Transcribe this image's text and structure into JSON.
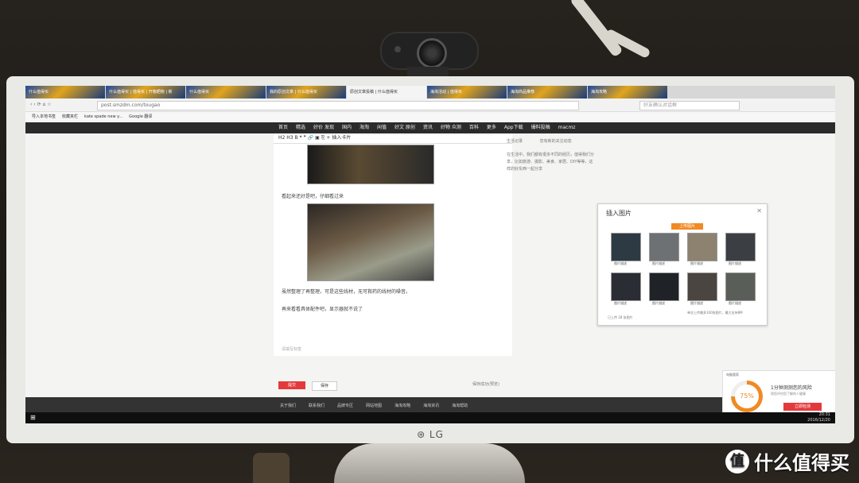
{
  "browser": {
    "tabs": [
      "什么值得买",
      "什么值得买 | 值得买 | 开箱晒物 | 新",
      "什么值得买",
      "我的原创文章 | 什么值得买",
      "原创文章投稿 | 什么值得买",
      "海淘活动 | 值得买",
      "海淘商品推荐",
      "海淘攻略"
    ],
    "active_tab_index": 4,
    "url": "post.smzdm.com/tougao",
    "search_placeholder": "好友确认对话框",
    "bookmarks": [
      "导入本地书签",
      "收藏夹栏",
      "kate spade new y...",
      "Google 翻译"
    ]
  },
  "site_nav": [
    "首页",
    "精选",
    "好价 发现",
    "国内",
    "海淘",
    "闲值",
    "好文 原创",
    "资讯",
    "好物 众测",
    "百科",
    "更多",
    "App下载",
    "爆料投稿",
    "macmz"
  ],
  "editor": {
    "toolbar": "H2  H3  B  ❝  ❞  🔗  ▣  ⎘  +  插入卡片",
    "caption1": "看起来还好是吧，仔细看过来",
    "text1": "虽然整理了再整理，可是这些线材，无可救药的线材的噪音。",
    "text2": "再来看看具体配件吧，显示器就不说了",
    "placeholder": "清填写标签",
    "submit_label": "提交",
    "save_label": "保存",
    "saved_text": "保存成功(预览)"
  },
  "sidebar": {
    "tab1": "生活记录",
    "tab2": "您有新的关注动态",
    "para": "在生活中，我们都有很多不同的经历，值得我们分享，比如旅游、摄影、美食、家居、DIY等等，这样的好东西一起分享"
  },
  "dialog": {
    "title": "插入图片",
    "upload_label": "上传图片",
    "thumb_caption": "图片描述",
    "count_text": "已上传 28 张图片",
    "hint_text": "单次上传最多100张图片，最大支持8M"
  },
  "footer": [
    "关于我们",
    "联系我们",
    "品牌专区",
    "网站地图",
    "海淘攻略",
    "海淘资讯",
    "海淘帮助"
  ],
  "taskbar": {
    "time": "20:31",
    "date": "2016/12/20"
  },
  "popup": {
    "head": "电脑管家",
    "score": "75%",
    "msg": "1分钟测测您的风险",
    "sub": "帮您评估您了解的人健康",
    "cta": "立即检测"
  },
  "monitor_brand": "⊛ LG",
  "watermark": "什么值得买",
  "colors": {
    "accent": "#e4393c",
    "orange": "#f08a24"
  }
}
